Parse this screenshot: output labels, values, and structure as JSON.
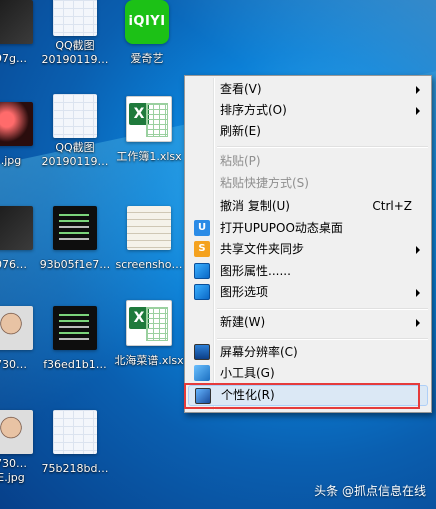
{
  "desktop_icons": [
    {
      "label": "97g…",
      "label2": "",
      "kind": "photo-dark"
    },
    {
      "label": "QQ截图",
      "label2": "20190119…",
      "kind": "shot"
    },
    {
      "label": "爱奇艺",
      "label2": "",
      "kind": "iqiyi"
    },
    {
      "label": ".jpg",
      "label2": "",
      "kind": "photo-red"
    },
    {
      "label": "QQ截图",
      "label2": "20190119…",
      "kind": "shot"
    },
    {
      "label": "工作簿1.xlsx",
      "label2": "",
      "kind": "excel"
    },
    {
      "label": "076…",
      "label2": "",
      "kind": "photo-dark"
    },
    {
      "label": "93b05f1e7…",
      "label2": "",
      "kind": "terminal"
    },
    {
      "label": "screensho…",
      "label2": "",
      "kind": "paper"
    },
    {
      "label": "730…",
      "label2": "",
      "kind": "face"
    },
    {
      "label": "f36ed1b1…",
      "label2": "",
      "kind": "terminal"
    },
    {
      "label": "北海菜谱.xlsx",
      "label2": "",
      "kind": "excel"
    },
    {
      "label": "730…",
      "label2": "E.jpg",
      "kind": "face"
    },
    {
      "label": "75b218bd…",
      "label2": "",
      "kind": "shot"
    }
  ],
  "iqiyi_logo_text": "iQIYI",
  "excel_badge": "X",
  "context_menu": {
    "items": [
      {
        "label": "查看(V)",
        "shortcut": "",
        "submenu": true,
        "disabled": false,
        "icon": ""
      },
      {
        "label": "排序方式(O)",
        "shortcut": "",
        "submenu": true,
        "disabled": false,
        "icon": ""
      },
      {
        "label": "刷新(E)",
        "shortcut": "",
        "submenu": false,
        "disabled": false,
        "icon": ""
      },
      {
        "label": "粘贴(P)",
        "shortcut": "",
        "submenu": false,
        "disabled": true,
        "icon": ""
      },
      {
        "label": "粘贴快捷方式(S)",
        "shortcut": "",
        "submenu": false,
        "disabled": true,
        "icon": ""
      },
      {
        "label": "撤消 复制(U)",
        "shortcut": "Ctrl+Z",
        "submenu": false,
        "disabled": false,
        "icon": ""
      },
      {
        "label": "打开UPUPOO动态桌面",
        "shortcut": "",
        "submenu": false,
        "disabled": false,
        "icon": "upupoo-icon"
      },
      {
        "label": "共享文件夹同步",
        "shortcut": "",
        "submenu": true,
        "disabled": false,
        "icon": "share-sync-icon"
      },
      {
        "label": "图形属性......",
        "shortcut": "",
        "submenu": false,
        "disabled": false,
        "icon": "graphics-properties-icon"
      },
      {
        "label": "图形选项",
        "shortcut": "",
        "submenu": true,
        "disabled": false,
        "icon": "graphics-options-icon"
      },
      {
        "label": "新建(W)",
        "shortcut": "",
        "submenu": true,
        "disabled": false,
        "icon": ""
      },
      {
        "label": "屏幕分辨率(C)",
        "shortcut": "",
        "submenu": false,
        "disabled": false,
        "icon": "screen-resolution-icon"
      },
      {
        "label": "小工具(G)",
        "shortcut": "",
        "submenu": false,
        "disabled": false,
        "icon": "gadgets-icon"
      },
      {
        "label": "个性化(R)",
        "shortcut": "",
        "submenu": false,
        "disabled": false,
        "icon": "personalize-icon",
        "highlighted": true
      }
    ],
    "icon_glyphs": {
      "upupoo": "U",
      "share": "S"
    }
  },
  "watermark": "头条 @抓点信息在线",
  "colors": {
    "highlight_border": "#e53b3b",
    "menu_bg": "#f0f0f0"
  }
}
